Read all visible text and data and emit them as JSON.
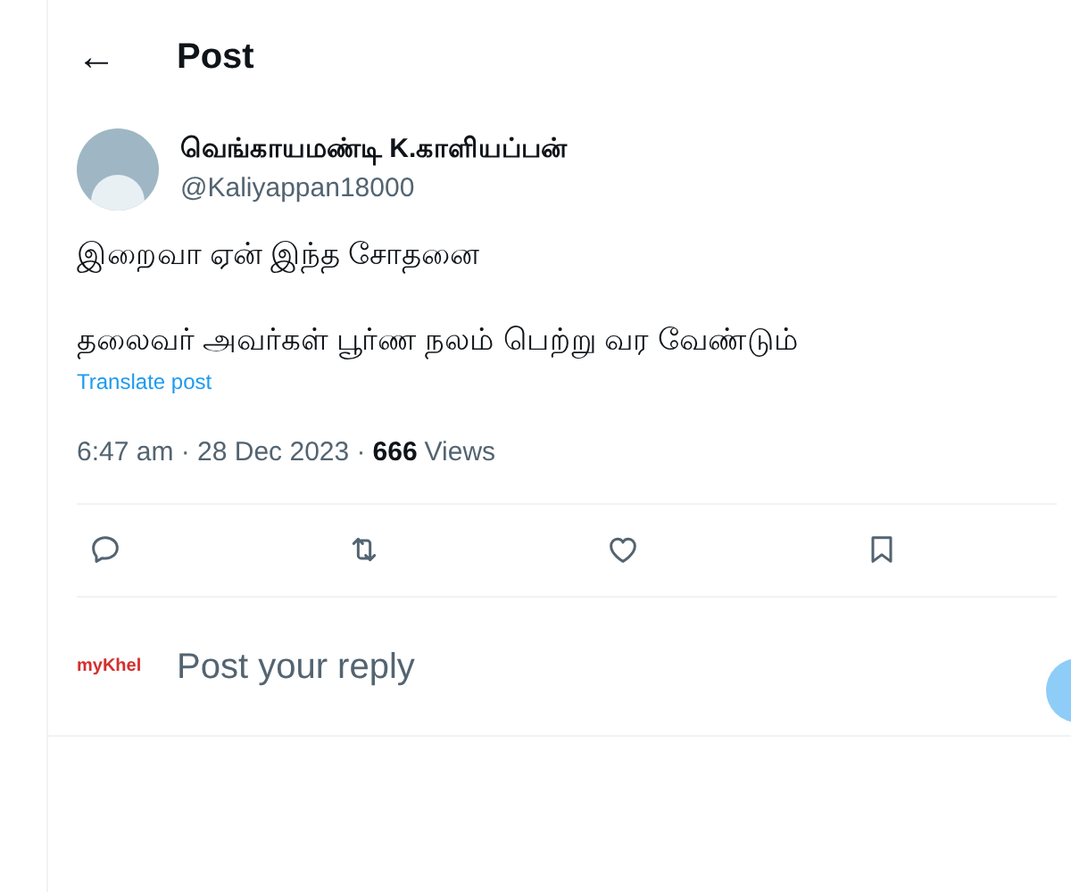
{
  "header": {
    "back": "←",
    "title": "Post"
  },
  "post": {
    "author_name": "வெங்காயமண்டி K.காளியப்பன்",
    "handle": "@Kaliyappan18000",
    "lines": [
      "இறைவா ஏன் இந்த சோதனை",
      "தலைவர் அவர்கள் பூர்ண நலம் பெற்று வர வேண்டும்"
    ],
    "translate": "Translate post",
    "timestamp": "6:47 am · 28 Dec 2023 ·",
    "views_count": "666",
    "views_label": "Views"
  },
  "actions": [
    {
      "kind": "reply"
    },
    {
      "kind": "repost"
    },
    {
      "kind": "like"
    },
    {
      "kind": "bookmark"
    }
  ],
  "reply_box": {
    "logo": "myKhel",
    "placeholder": "Post your reply"
  }
}
